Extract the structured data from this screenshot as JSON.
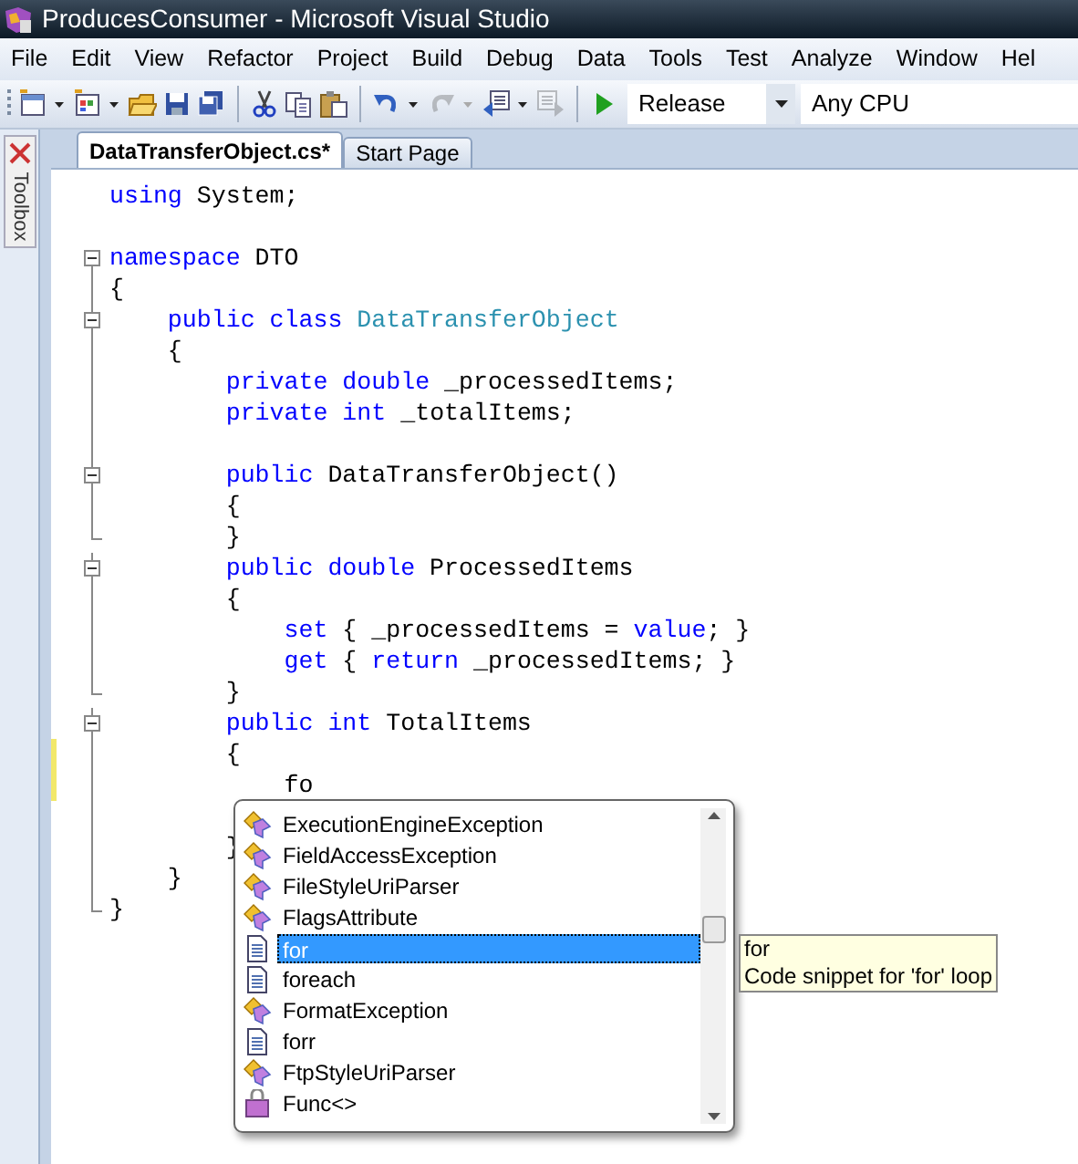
{
  "window": {
    "title": "ProducesConsumer - Microsoft Visual Studio"
  },
  "menu": [
    "File",
    "Edit",
    "View",
    "Refactor",
    "Project",
    "Build",
    "Debug",
    "Data",
    "Tools",
    "Test",
    "Analyze",
    "Window",
    "Hel"
  ],
  "toolbar": {
    "buttons": [
      {
        "kind": "project",
        "dropdown": true,
        "disabled": false
      },
      {
        "kind": "additem",
        "dropdown": true,
        "disabled": false
      },
      {
        "kind": "open",
        "dropdown": false,
        "disabled": false
      },
      {
        "kind": "save",
        "dropdown": false,
        "disabled": false
      },
      {
        "kind": "saveall",
        "dropdown": false,
        "disabled": false
      },
      {
        "kind": "sep"
      },
      {
        "kind": "cut",
        "dropdown": false,
        "disabled": false
      },
      {
        "kind": "copy",
        "dropdown": false,
        "disabled": false
      },
      {
        "kind": "paste",
        "dropdown": false,
        "disabled": false
      },
      {
        "kind": "sep"
      },
      {
        "kind": "undo",
        "dropdown": true,
        "disabled": false
      },
      {
        "kind": "redo",
        "dropdown": true,
        "disabled": true
      },
      {
        "kind": "navback",
        "dropdown": true,
        "disabled": false
      },
      {
        "kind": "navfwd",
        "dropdown": false,
        "disabled": true
      },
      {
        "kind": "sep"
      },
      {
        "kind": "start",
        "dropdown": false,
        "disabled": false
      }
    ],
    "configuration": "Release",
    "platform": "Any CPU"
  },
  "toolbox_tab": "Toolbox",
  "tabs": [
    {
      "label": "DataTransferObject.cs*",
      "selected": true
    },
    {
      "label": "Start Page",
      "selected": false
    }
  ],
  "code_lines": [
    {
      "kind": "plain",
      "tokens": [
        {
          "text": "using",
          "kind": "keyword"
        },
        {
          "text": " System;",
          "kind": "plain"
        }
      ]
    },
    {
      "kind": "plain"
    },
    {
      "kind": "fold-start",
      "tokens": [
        {
          "text": "namespace",
          "kind": "keyword"
        },
        {
          "text": " DTO",
          "kind": "plain"
        }
      ]
    },
    {
      "kind": "fold-line",
      "tokens": [
        {
          "text": "{",
          "kind": "plain"
        }
      ]
    },
    {
      "kind": "fold-start",
      "tokens": [
        {
          "text": "    public",
          "kind": "keyword"
        },
        {
          "text": " class",
          "kind": "keyword"
        },
        {
          "text": " DataTransferObject",
          "kind": "type"
        }
      ]
    },
    {
      "kind": "fold-line",
      "tokens": [
        {
          "text": "    {",
          "kind": "plain"
        }
      ]
    },
    {
      "kind": "fold-line",
      "tokens": [
        {
          "text": "        private",
          "kind": "keyword"
        },
        {
          "text": " double",
          "kind": "keyword"
        },
        {
          "text": " _processedItems;",
          "kind": "plain"
        }
      ]
    },
    {
      "kind": "fold-line",
      "tokens": [
        {
          "text": "        private",
          "kind": "keyword"
        },
        {
          "text": " int",
          "kind": "keyword"
        },
        {
          "text": " _totalItems;",
          "kind": "plain"
        }
      ]
    },
    {
      "kind": "fold-line"
    },
    {
      "kind": "fold-start",
      "tokens": [
        {
          "text": "        public",
          "kind": "keyword"
        },
        {
          "text": " DataTransferObject()",
          "kind": "plain"
        }
      ]
    },
    {
      "kind": "fold-line",
      "tokens": [
        {
          "text": "        {",
          "kind": "plain"
        }
      ]
    },
    {
      "kind": "fold-end",
      "tokens": [
        {
          "text": "        }",
          "kind": "plain"
        }
      ]
    },
    {
      "kind": "fold-start",
      "tokens": [
        {
          "text": "        public",
          "kind": "keyword"
        },
        {
          "text": " double",
          "kind": "keyword"
        },
        {
          "text": " ProcessedItems",
          "kind": "plain"
        }
      ]
    },
    {
      "kind": "fold-line",
      "tokens": [
        {
          "text": "        {",
          "kind": "plain"
        }
      ]
    },
    {
      "kind": "fold-line",
      "tokens": [
        {
          "text": "            set",
          "kind": "keyword"
        },
        {
          "text": " { _processedItems = ",
          "kind": "plain"
        },
        {
          "text": "value",
          "kind": "keyword"
        },
        {
          "text": "; }",
          "kind": "plain"
        }
      ]
    },
    {
      "kind": "fold-line",
      "tokens": [
        {
          "text": "            get",
          "kind": "keyword"
        },
        {
          "text": " { ",
          "kind": "plain"
        },
        {
          "text": "return",
          "kind": "keyword"
        },
        {
          "text": " _processedItems; }",
          "kind": "plain"
        }
      ]
    },
    {
      "kind": "fold-end",
      "tokens": [
        {
          "text": "        }",
          "kind": "plain"
        }
      ]
    },
    {
      "kind": "fold-start",
      "tokens": [
        {
          "text": "        public",
          "kind": "keyword"
        },
        {
          "text": " int",
          "kind": "keyword"
        },
        {
          "text": " TotalItems",
          "kind": "plain"
        }
      ]
    },
    {
      "kind": "fold-line",
      "changed": true,
      "tokens": [
        {
          "text": "        {",
          "kind": "plain"
        }
      ]
    },
    {
      "kind": "fold-line",
      "changed": true,
      "tokens": [
        {
          "text": "            fo",
          "kind": "plain"
        }
      ]
    },
    {
      "kind": "fold-line"
    },
    {
      "kind": "fold-line",
      "tokens": [
        {
          "text": "        }",
          "kind": "plain"
        }
      ]
    },
    {
      "kind": "fold-line",
      "tokens": [
        {
          "text": "    }",
          "kind": "plain"
        }
      ]
    },
    {
      "kind": "fold-end",
      "tokens": [
        {
          "text": "}",
          "kind": "plain"
        }
      ]
    }
  ],
  "completion": {
    "items": [
      {
        "label": "ExecutionEngineException",
        "kind": "class",
        "selected": false
      },
      {
        "label": "FieldAccessException",
        "kind": "class",
        "selected": false
      },
      {
        "label": "FileStyleUriParser",
        "kind": "class",
        "selected": false
      },
      {
        "label": "FlagsAttribute",
        "kind": "class",
        "selected": false
      },
      {
        "label": "for",
        "kind": "snippet",
        "selected": true
      },
      {
        "label": "foreach",
        "kind": "snippet",
        "selected": false
      },
      {
        "label": "FormatException",
        "kind": "class",
        "selected": false
      },
      {
        "label": "forr",
        "kind": "snippet",
        "selected": false
      },
      {
        "label": "FtpStyleUriParser",
        "kind": "class",
        "selected": false
      },
      {
        "label": "Func<>",
        "kind": "delegate",
        "selected": false
      }
    ],
    "tooltip": {
      "title": "for",
      "description": "Code snippet for 'for' loop"
    }
  }
}
